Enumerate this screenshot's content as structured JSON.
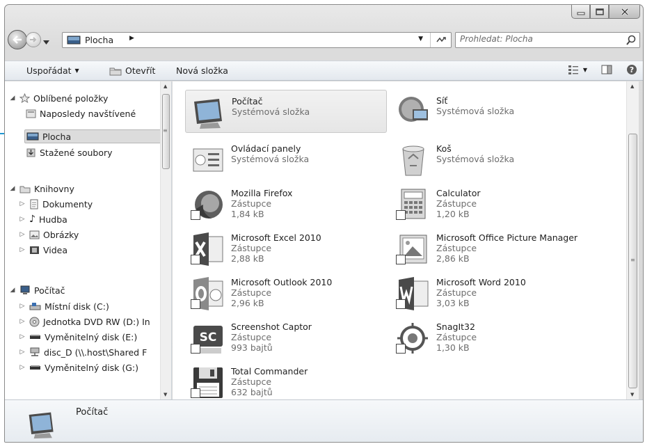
{
  "address": {
    "location": "Plocha",
    "search_placeholder": "Prohledat: Plocha"
  },
  "toolbar": {
    "organize": "Uspořádat",
    "open": "Otevřít",
    "new_folder": "Nová složka"
  },
  "navigation": {
    "favorites": {
      "label": "Oblíbené položky",
      "items": [
        "Naposledy navštívené",
        "Plocha",
        "Stažené soubory"
      ]
    },
    "libraries": {
      "label": "Knihovny",
      "items": [
        "Dokumenty",
        "Hudba",
        "Obrázky",
        "Videa"
      ]
    },
    "computer": {
      "label": "Počítač",
      "items": [
        "Místní disk (C:)",
        "Jednotka DVD RW (D:) In",
        "Vyměnitelný disk (E:)",
        "disc_D (\\\\.host\\Shared F",
        "Vyměnitelný disk (G:)"
      ]
    }
  },
  "items": [
    {
      "name": "Počítač",
      "line2": "Systémová složka",
      "line3": "",
      "icon": "computer-icon"
    },
    {
      "name": "Síť",
      "line2": "Systémová složka",
      "line3": "",
      "icon": "network-icon"
    },
    {
      "name": "Ovládací panely",
      "line2": "Systémová složka",
      "line3": "",
      "icon": "control-panel-icon"
    },
    {
      "name": "Koš",
      "line2": "Systémová složka",
      "line3": "",
      "icon": "recycle-bin-icon"
    },
    {
      "name": "Mozilla Firefox",
      "line2": "Zástupce",
      "line3": "1,84 kB",
      "icon": "firefox-icon"
    },
    {
      "name": "Calculator",
      "line2": "Zástupce",
      "line3": "1,20 kB",
      "icon": "calculator-icon"
    },
    {
      "name": "Microsoft Excel 2010",
      "line2": "Zástupce",
      "line3": "2,88 kB",
      "icon": "excel-icon"
    },
    {
      "name": "Microsoft Office Picture Manager",
      "line2": "Zástupce",
      "line3": "2,86 kB",
      "icon": "picture-manager-icon"
    },
    {
      "name": "Microsoft Outlook 2010",
      "line2": "Zástupce",
      "line3": "2,96 kB",
      "icon": "outlook-icon"
    },
    {
      "name": "Microsoft Word 2010",
      "line2": "Zástupce",
      "line3": "3,03 kB",
      "icon": "word-icon"
    },
    {
      "name": "Screenshot Captor",
      "line2": "Zástupce",
      "line3": "993 bajtů",
      "icon": "screenshot-captor-icon"
    },
    {
      "name": "SnagIt32",
      "line2": "Zástupce",
      "line3": "1,30 kB",
      "icon": "snagit-icon"
    },
    {
      "name": "Total Commander",
      "line2": "Zástupce",
      "line3": "632 bajtů",
      "icon": "total-commander-icon"
    }
  ],
  "details": {
    "title": "Počítač"
  },
  "colors": {
    "callout": "#1f97d1"
  }
}
